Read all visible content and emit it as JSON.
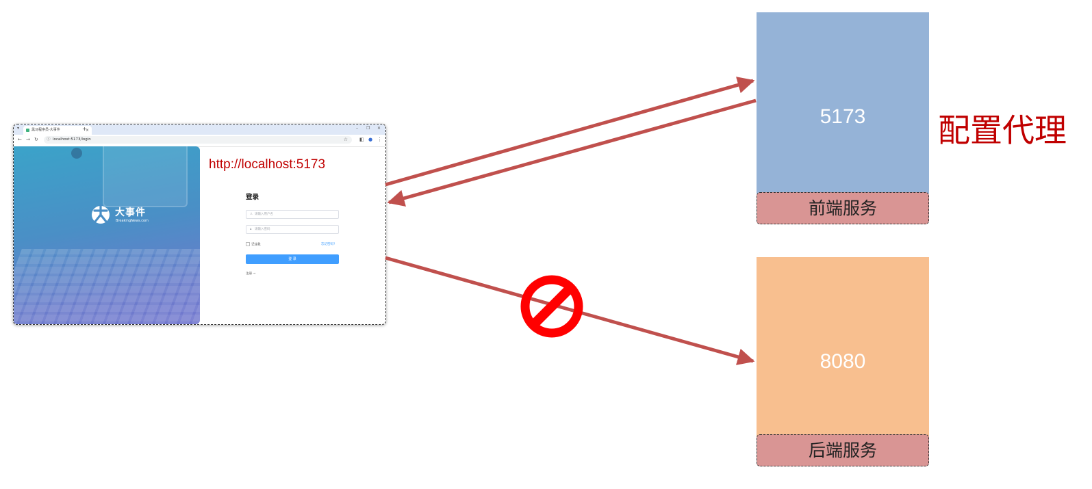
{
  "browser": {
    "tab_title": "黑马程序员-大事件",
    "url": "localhost:5173/login",
    "logo_cn": "大事件",
    "logo_en": "BreakingNews.com",
    "login": {
      "title": "登录",
      "username_placeholder": "请输入用户名",
      "password_placeholder": "请输入密码",
      "remember_label": "记住我",
      "forgot_label": "忘记密码?",
      "submit_label": "登 录",
      "register_label": "注册 →"
    }
  },
  "origin_url": "http://localhost:5173",
  "frontend": {
    "port": "5173",
    "label": "前端服务",
    "color": "#95b3d7"
  },
  "backend": {
    "port": "8080",
    "label": "后端服务",
    "color": "#f8bf8f"
  },
  "proxy_label": "配置代理",
  "colors": {
    "arrow": "#c0504d",
    "highlight_text": "#c00000",
    "service_bar": "#d99594",
    "forbidden": "#ff0000"
  }
}
